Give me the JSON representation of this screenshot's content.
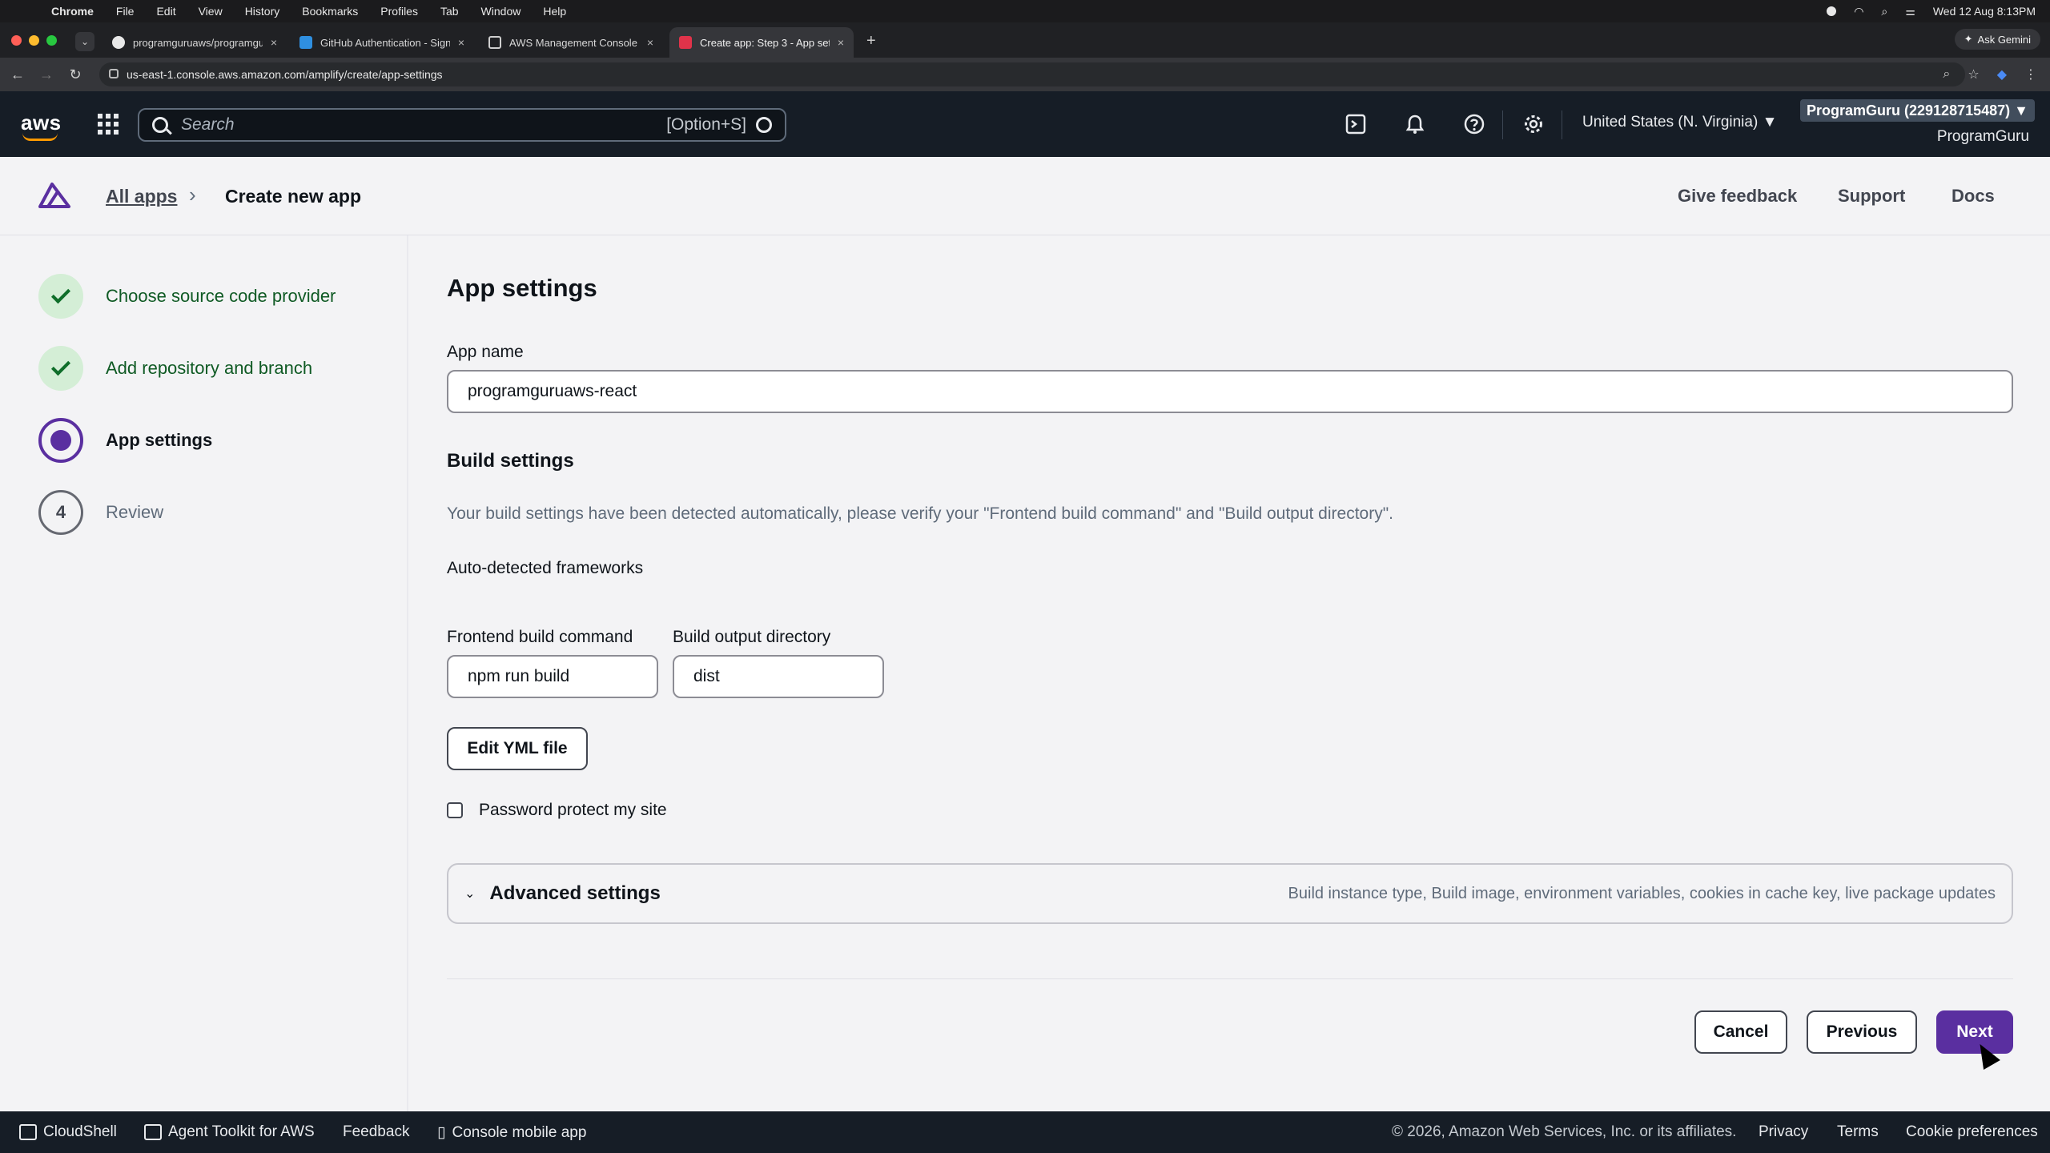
{
  "os_menubar": {
    "app": "Chrome",
    "menus": [
      "File",
      "Edit",
      "View",
      "History",
      "Bookmarks",
      "Profiles",
      "Tab",
      "Window",
      "Help"
    ],
    "datetime": "Wed 12 Aug  8:13PM"
  },
  "browser": {
    "tabs": [
      {
        "title": "programguruaws/programgu",
        "icon": "github-icon",
        "active": false
      },
      {
        "title": "GitHub Authentication - Sign",
        "icon": "vscode-icon",
        "active": false
      },
      {
        "title": "AWS Management Console",
        "icon": "aws-cube-icon",
        "active": false
      },
      {
        "title": "Create app: Step 3 - App sett",
        "icon": "amplify-icon",
        "active": true
      }
    ],
    "ask_gemini": "Ask Gemini",
    "url": "us-east-1.console.aws.amazon.com/amplify/create/app-settings"
  },
  "aws_nav": {
    "logo": "aws",
    "search_placeholder": "Search",
    "search_shortcut": "[Option+S]",
    "region": "United States (N. Virginia) ▼",
    "account": "ProgramGuru (229128715487) ▼",
    "account_name": "ProgramGuru"
  },
  "header": {
    "breadcrumb_link": "All apps",
    "breadcrumb_current": "Create new app",
    "links": [
      "Give feedback",
      "Support",
      "Docs"
    ]
  },
  "steps": [
    {
      "number": "",
      "label": "Choose source code provider",
      "state": "done"
    },
    {
      "number": "",
      "label": "Add repository and branch",
      "state": "done"
    },
    {
      "number": "",
      "label": "App settings",
      "state": "current"
    },
    {
      "number": "4",
      "label": "Review",
      "state": "todo"
    }
  ],
  "main": {
    "title": "App settings",
    "app_name_label": "App name",
    "app_name_value": "programguruaws-react",
    "build_settings_title": "Build settings",
    "build_settings_desc": "Your build settings have been detected automatically, please verify your \"Frontend build command\" and \"Build output directory\".",
    "frameworks_label": "Auto-detected frameworks",
    "build_command_label": "Frontend build command",
    "build_command_value": "npm run build",
    "output_dir_label": "Build output directory",
    "output_dir_value": "dist",
    "edit_yml_button": "Edit YML file",
    "password_protect_label": "Password protect my site",
    "password_protect_checked": false,
    "advanced_title": "Advanced settings",
    "advanced_desc": "Build instance type, Build image, environment variables, cookies in cache key, live package updates"
  },
  "actions": {
    "cancel": "Cancel",
    "previous": "Previous",
    "next": "Next"
  },
  "footer": {
    "cloudshell": "CloudShell",
    "agent_toolkit": "Agent Toolkit for AWS",
    "feedback": "Feedback",
    "console_mobile": "Console mobile app",
    "copyright": "© 2026, Amazon Web Services, Inc. or its affiliates.",
    "privacy": "Privacy",
    "terms": "Terms",
    "cookie_prefs": "Cookie preferences"
  },
  "colors": {
    "primary": "#5a2fa0",
    "success": "#0f6e2a",
    "nav_bg": "#161d26"
  }
}
